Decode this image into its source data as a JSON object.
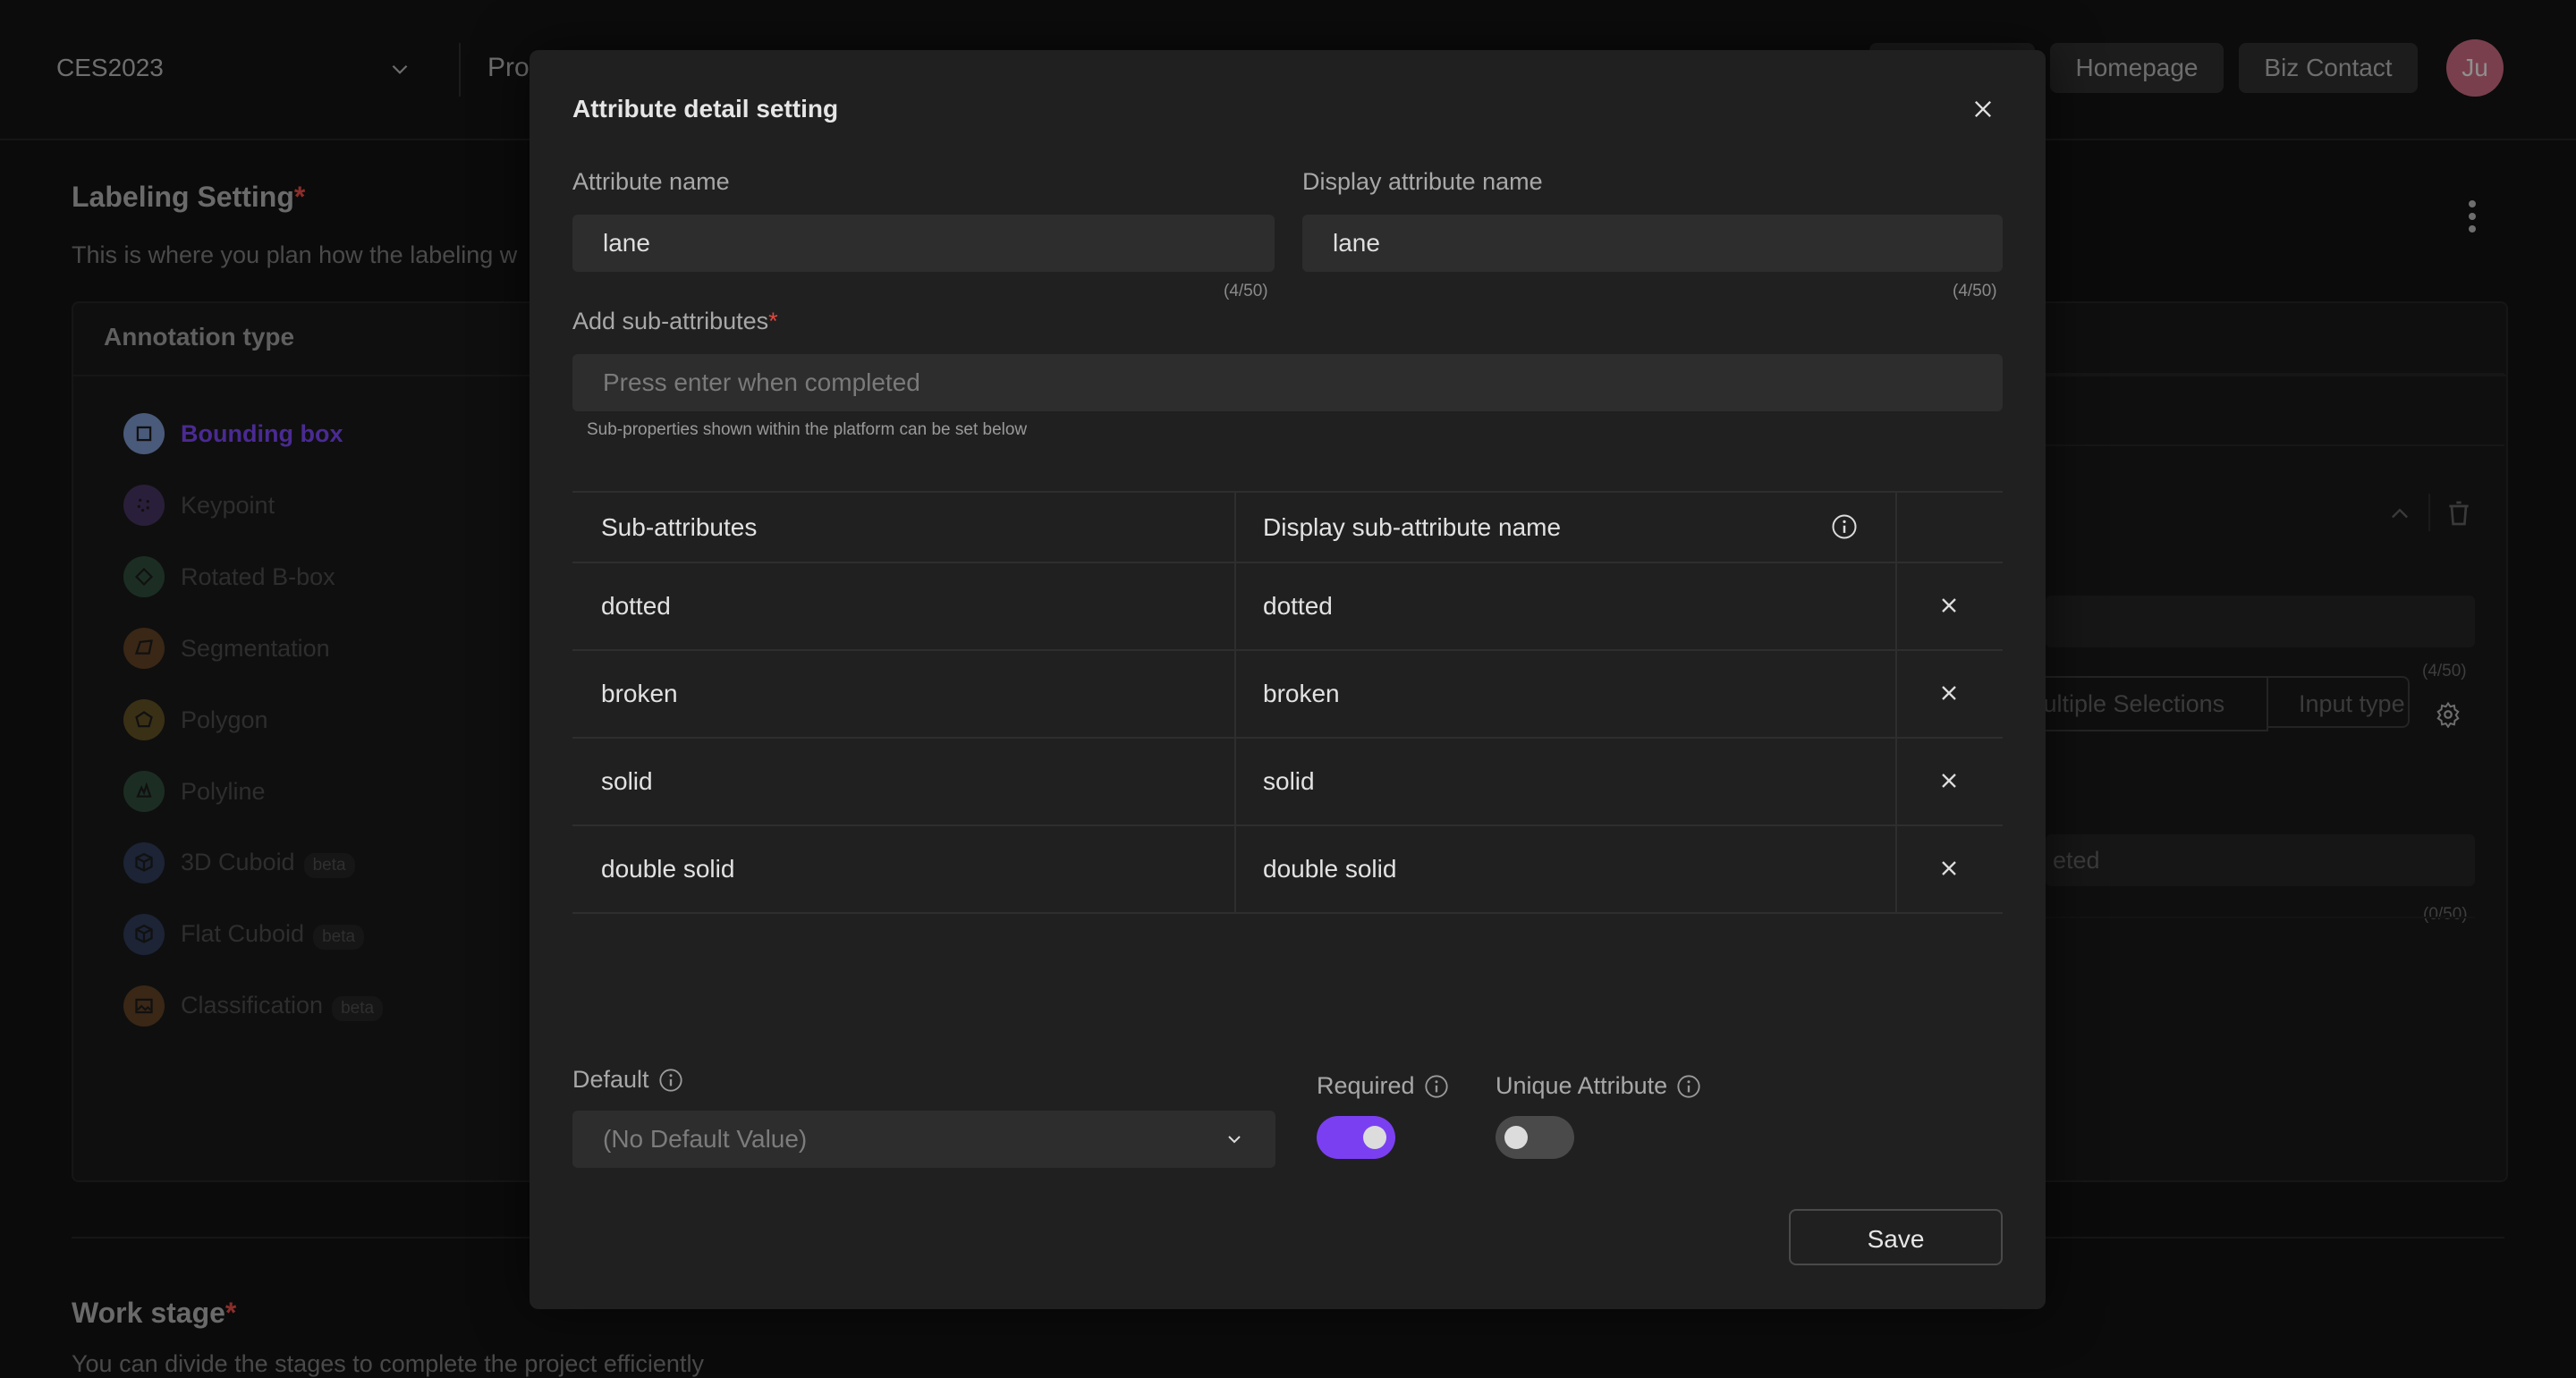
{
  "header": {
    "project_select": "CES2023",
    "page_title_partial": "Pro",
    "buttons": [
      "Homepage",
      "Biz Contact"
    ],
    "avatar_initials": "Ju",
    "avatar_color": "#7a3f4d"
  },
  "labeling": {
    "title": "Labeling Setting",
    "required_mark": "*",
    "description": "This is where you plan how the labeling w",
    "annotation_type_header": "Annotation type",
    "annotation_types": [
      {
        "label": "Bounding box",
        "icon": "bounding-box-icon",
        "color": "#4a5a7a",
        "active": true,
        "beta": false
      },
      {
        "label": "Keypoint",
        "icon": "keypoint-icon",
        "color": "#2a1f3a",
        "active": false,
        "beta": false
      },
      {
        "label": "Rotated B-box",
        "icon": "rotated-bbox-icon",
        "color": "#1c2e24",
        "active": false,
        "beta": false
      },
      {
        "label": "Segmentation",
        "icon": "segmentation-icon",
        "color": "#3a2716",
        "active": false,
        "beta": false
      },
      {
        "label": "Polygon",
        "icon": "polygon-icon",
        "color": "#3a3016",
        "active": false,
        "beta": false
      },
      {
        "label": "Polyline",
        "icon": "polyline-icon",
        "color": "#1c2e24",
        "active": false,
        "beta": false
      },
      {
        "label": "3D Cuboid",
        "icon": "cuboid-icon",
        "color": "#1c2436",
        "active": false,
        "beta": true
      },
      {
        "label": "Flat Cuboid",
        "icon": "cuboid-icon",
        "color": "#1c2436",
        "active": false,
        "beta": true
      },
      {
        "label": "Classification",
        "icon": "image-icon",
        "color": "#3a2716",
        "active": false,
        "beta": true
      }
    ],
    "beta_label": "beta"
  },
  "work_stage": {
    "title": "Work stage",
    "required_mark": "*",
    "description": "You can divide the stages to complete the project efficiently"
  },
  "right_panel": {
    "counter_1": "(4/50)",
    "segment_options": [
      "Multiple Selections",
      "Input type"
    ],
    "input_placeholder_partial": "eted",
    "counter_2": "(0/50)"
  },
  "modal": {
    "title": "Attribute detail setting",
    "attribute_name": {
      "label": "Attribute name",
      "value": "lane",
      "counter": "(4/50)"
    },
    "display_attribute_name": {
      "label": "Display attribute name",
      "value": "lane",
      "counter": "(4/50)"
    },
    "add_sub_attributes": {
      "label": "Add sub-attributes",
      "required_mark": "*",
      "placeholder": "Press enter when completed",
      "hint": "Sub-properties shown within the platform can be set below"
    },
    "table": {
      "columns": [
        "Sub-attributes",
        "Display sub-attribute name"
      ],
      "rows": [
        {
          "sub_attribute": "dotted",
          "display_name": "dotted"
        },
        {
          "sub_attribute": "broken",
          "display_name": "broken"
        },
        {
          "sub_attribute": "solid",
          "display_name": "solid"
        },
        {
          "sub_attribute": "double solid",
          "display_name": "double solid"
        }
      ]
    },
    "default": {
      "label": "Default",
      "selected": "(No Default Value)"
    },
    "required": {
      "label": "Required",
      "on": true
    },
    "unique_attribute": {
      "label": "Unique Attribute",
      "on": false
    },
    "accent_color": "#7b3ff2",
    "save_label": "Save"
  }
}
